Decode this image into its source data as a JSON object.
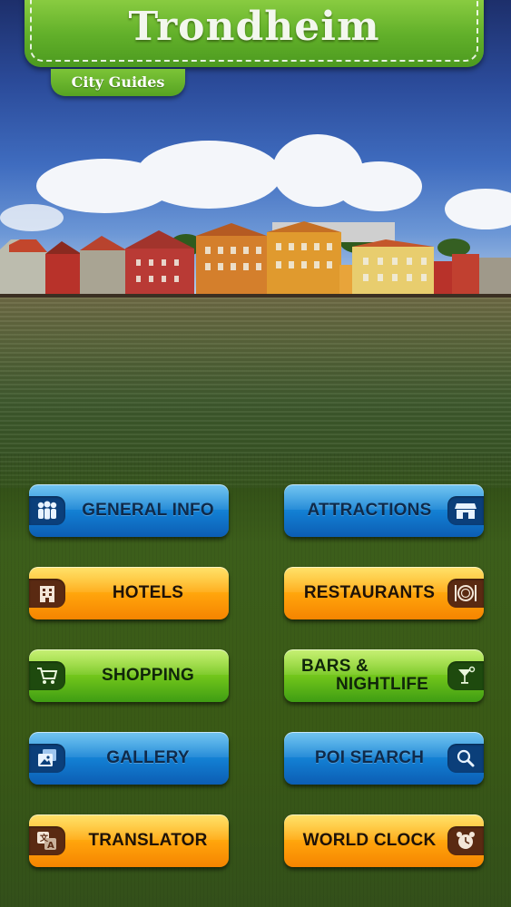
{
  "header": {
    "title": "Trondheim",
    "subtitle": "City Guides",
    "accent": "#62b02a"
  },
  "menu": {
    "general_info": {
      "label": "GENERAL INFO",
      "icon": "people-icon",
      "color": "blue"
    },
    "attractions": {
      "label": "ATTRACTIONS",
      "icon": "storefront-icon",
      "color": "blue"
    },
    "hotels": {
      "label": "HOTELS",
      "icon": "hotel-building-icon",
      "color": "orange"
    },
    "restaurants": {
      "label": "RESTAURANTS",
      "icon": "plate-cutlery-icon",
      "color": "orange"
    },
    "shopping": {
      "label": "SHOPPING",
      "icon": "shopping-cart-icon",
      "color": "green"
    },
    "bars_nightlife": {
      "label_line1": "BARS &",
      "label_line2": "NIGHTLIFE",
      "icon": "cocktail-icon",
      "color": "green"
    },
    "gallery": {
      "label": "GALLERY",
      "icon": "photo-gallery-icon",
      "color": "blue"
    },
    "poi_search": {
      "label": "POI SEARCH",
      "icon": "magnifier-icon",
      "color": "blue"
    },
    "translator": {
      "label": "TRANSLATOR",
      "icon": "translate-icon",
      "color": "orange"
    },
    "world_clock": {
      "label": "WORLD CLOCK",
      "icon": "alarm-clock-icon",
      "color": "orange"
    }
  },
  "colors": {
    "blue": "#127dd1",
    "orange": "#ffa20b",
    "green": "#6dc21a"
  }
}
